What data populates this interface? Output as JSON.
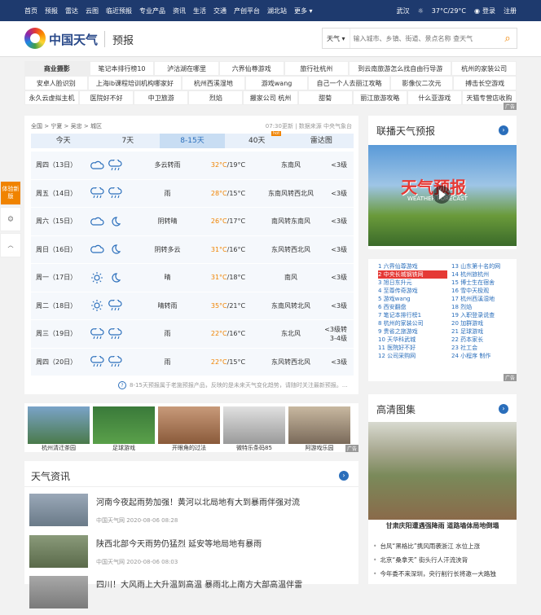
{
  "topbar": {
    "nav": [
      "首页",
      "预报",
      "雷达",
      "云图",
      "临近预报",
      "专业产品",
      "资讯",
      "生活",
      "交通",
      "产创平台",
      "湖北站",
      "更多 ▾"
    ],
    "city": "武汉",
    "temp": "37°C/29°C",
    "login": "登录",
    "register": "注册"
  },
  "header": {
    "brand": "中国天气",
    "section": "预报",
    "search_scope": "天气 ▾",
    "search_placeholder": "输入城市、乡镇、街道、景点名称 查天气"
  },
  "tags": [
    [
      "商业摄影",
      "笔记本排行榜10",
      "泸沽湖在哪里",
      "六界仙尊游戏",
      "旅行社杭州",
      "到云南旅游怎么找自由行导游",
      "杭州的家装公司"
    ],
    [
      "安卓人脸识别",
      "上海ib课程培训机构哪家好",
      "杭州西溪湿地",
      "游戏wang",
      "自己一个人去丽江攻略",
      "影像仪二次元",
      "搏击长空游戏"
    ],
    [
      "永久云虚拟主机",
      "医院好不好",
      "中卫旅游",
      "烈焰",
      "搬家公司 杭州",
      "甜菊",
      "丽江旅游攻略",
      "什么亚游戏",
      "天猫专营店收购"
    ]
  ],
  "ad_label": "广告",
  "breadcrumb": "全国 > 宁夏 > 吴忠 > 城区",
  "source": "07:30更新 | 数据来源 中央气象台",
  "tabs": [
    "今天",
    "7天",
    "8-15天",
    "40天",
    "雷达图"
  ],
  "hot_badge": "hot",
  "days": [
    {
      "date": "周四（13日）",
      "weather": "多云转雨",
      "high": "32°C",
      "low": "/19°C",
      "wind": "东南风",
      "level": "<3级",
      "icons": [
        "cloud",
        "rain"
      ]
    },
    {
      "date": "周五（14日）",
      "weather": "雨",
      "high": "28°C",
      "low": "/15°C",
      "wind": "东南风转西北风",
      "level": "<3级",
      "icons": [
        "rain",
        "rain"
      ]
    },
    {
      "date": "周六（15日）",
      "weather": "阴转晴",
      "high": "26°C",
      "low": "/17°C",
      "wind": "南风转东南风",
      "level": "<3级",
      "icons": [
        "cloud",
        "moon"
      ]
    },
    {
      "date": "周日（16日）",
      "weather": "阴转多云",
      "high": "31°C",
      "low": "/16°C",
      "wind": "东风转西北风",
      "level": "<3级",
      "icons": [
        "cloud",
        "moon"
      ]
    },
    {
      "date": "周一（17日）",
      "weather": "晴",
      "high": "31°C",
      "low": "/18°C",
      "wind": "南风",
      "level": "<3级",
      "icons": [
        "sun",
        "moon"
      ]
    },
    {
      "date": "周二（18日）",
      "weather": "晴转雨",
      "high": "35°C",
      "low": "/21°C",
      "wind": "东南风转北风",
      "level": "<3级",
      "icons": [
        "sun",
        "rain"
      ]
    },
    {
      "date": "周三（19日）",
      "weather": "雨",
      "high": "22°C",
      "low": "/16°C",
      "wind": "东北风",
      "level": "<3级转3-4级",
      "icons": [
        "rain",
        "rain"
      ]
    },
    {
      "date": "周四（20日）",
      "weather": "雨",
      "high": "22°C",
      "low": "/15°C",
      "wind": "东风转西北风",
      "level": "<3级",
      "icons": [
        "rain",
        "rain"
      ]
    }
  ],
  "note": "8-15天预报属于老施预报产品，反映的是未来天气变化趋势，请随时关注最新预报。...",
  "sidebar_left": {
    "experience": "体验新版"
  },
  "lianbo": {
    "title": "联播天气预报",
    "video_title": "天气预报",
    "video_sub": "WEATHER FORECAST"
  },
  "rank_left": [
    "1 六界仙尊游戏",
    "2 中央长城钢铁网",
    "3 旭日东升元",
    "4 至尊传奇游戏",
    "5 游戏wang",
    "6 西安翻盘",
    "7 笔记本排行榜1",
    "8 杭州的家装公司",
    "9 贵省之旅游戏",
    "10 天华科武城",
    "11 医院好不好",
    "12 公司采购网"
  ],
  "rank_right": [
    "13 山东第十名的网",
    "14 杭州旅杭州",
    "15 博士生在宿舍",
    "16 雪中天极观",
    "17 杭州西溪湿地",
    "18 烈焰",
    "19 入职登录说查",
    "20 加群游戏",
    "21 足球游戏",
    "22 药本家长",
    "23 社工会",
    "24 小程序 制作"
  ],
  "pics": [
    "杭州清迁茶园",
    "足球游戏",
    "开眼角的过法",
    "微特乐条码85",
    "阿游戏乐园"
  ],
  "news": {
    "title": "天气资讯",
    "items": [
      {
        "title": "河南今夜起雨势加强！黄河以北局地有大到暴雨伴强对流",
        "meta": "中国天气网 2020-08-06 08:28"
      },
      {
        "title": "陕西北部今天雨势仍猛烈 延安等地局地有暴雨",
        "meta": "中国天气网 2020-08-06 08:03"
      },
      {
        "title": "四川！大风雨上大升温到高温 暴雨北上南方大部高温伴雷",
        "meta": ""
      }
    ]
  },
  "hd": {
    "title": "高清图集",
    "caption": "甘肃庆阳遭遇强降雨 道路墙体局地倒塌",
    "links": [
      "台风“黑格比”携风雨袭浙江 水位上涨",
      "北京“桑拿天” 街头行人汗流浃背",
      "今年委不来深圳，央行削行长将邀一大路独"
    ]
  },
  "colors": {
    "topbar": "#1e3a6e",
    "accent": "#f08300",
    "link": "#2a6ebb"
  }
}
